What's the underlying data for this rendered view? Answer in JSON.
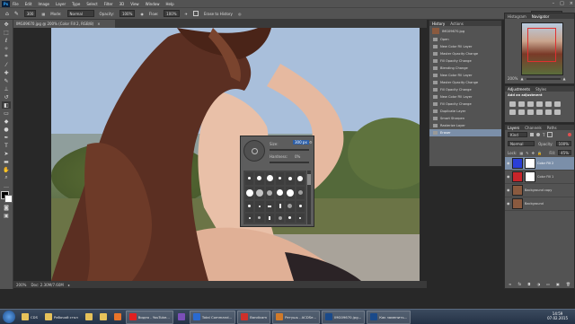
{
  "app": {
    "logo": "Ps"
  },
  "menu": [
    "File",
    "Edit",
    "Image",
    "Layer",
    "Type",
    "Select",
    "Filter",
    "3D",
    "View",
    "Window",
    "Help"
  ],
  "options_bar": {
    "tool_icon": "brush-icon",
    "size_value": "300",
    "mode_label": "Mode:",
    "mode_value": "Normal",
    "opacity_label": "Opacity:",
    "opacity_value": "100%",
    "flow_label": "Flow:",
    "flow_value": "100%",
    "erase_history_label": "Erase to History",
    "workspace": "Photography"
  },
  "document": {
    "tab_title": "IMG09670.jpg @ 200% (Color Fill 2, RGB/8)",
    "zoom": "200%",
    "doc_size": "Doc: 2.30M/7.60M"
  },
  "history": {
    "tabs": [
      "History",
      "Actions"
    ],
    "snapshot": "IMG09670.jpg",
    "items": [
      "Open",
      "New Color Fill Layer",
      "Master Opacity Change",
      "Fill Opacity Change",
      "Blending Change",
      "New Color Fill Layer",
      "Master Opacity Change",
      "Fill Opacity Change",
      "New Color Fill Layer",
      "Fill Opacity Change",
      "Duplicate Layer",
      "Smart Sharpen",
      "Rasterize Layer",
      "Eraser"
    ],
    "selected_index": 13
  },
  "navigator": {
    "tabs": [
      "Histogram",
      "Navigator"
    ],
    "zoom": "200%"
  },
  "adjustments": {
    "tabs": [
      "Adjustments",
      "Styles"
    ],
    "subtitle": "Add an adjustment"
  },
  "layers": {
    "tabs": [
      "Layers",
      "Channels",
      "Paths"
    ],
    "kind_label": "Kind",
    "blend_mode": "Normal",
    "opacity_label": "Opacity:",
    "opacity_value": "100%",
    "lock_label": "Lock:",
    "fill_label": "Fill:",
    "fill_value": "45%",
    "items": [
      {
        "name": "Color Fill 2",
        "selected": true,
        "swatch": "#2a3fd8"
      },
      {
        "name": "Color Fill 1",
        "selected": false,
        "swatch": "#c8252a"
      },
      {
        "name": "Background copy",
        "selected": false,
        "swatch": "#8a5a3f"
      },
      {
        "name": "Background",
        "selected": false,
        "swatch": "#8a5a3f"
      }
    ]
  },
  "brush_picker": {
    "size_label": "Size:",
    "size_value": "300 px",
    "hardness_label": "Hardness:",
    "hardness_value": "0%"
  },
  "taskbar": {
    "items": [
      {
        "label": "CDS",
        "icon": "folder-icon",
        "color": "#e6c25a"
      },
      {
        "label": "Рабочий стол",
        "icon": "folder-icon",
        "color": "#e6c25a"
      },
      {
        "label": "",
        "icon": "folder-icon",
        "color": "#e6c25a"
      },
      {
        "label": "",
        "icon": "folder-icon",
        "color": "#e6c25a"
      },
      {
        "label": "",
        "icon": "firefox-icon",
        "color": "#e8742a"
      },
      {
        "label": "Видео - YouTube...",
        "icon": "youtube-icon",
        "color": "#e02020"
      },
      {
        "label": "",
        "icon": "viber-icon",
        "color": "#7a4fb8"
      },
      {
        "label": "Total Command...",
        "icon": "totalcmd-icon",
        "color": "#2a6ad0"
      },
      {
        "label": "Bandicam",
        "icon": "bandicam-icon",
        "color": "#d0302a"
      },
      {
        "label": "Ретушь - ACDSe...",
        "icon": "acdsee-icon",
        "color": "#d07a2a"
      },
      {
        "label": "IMG09670.jpg...",
        "icon": "photoshop-icon",
        "color": "#1a4a8a"
      },
      {
        "label": "Как заменить...",
        "icon": "photoshop-icon",
        "color": "#1a4a8a"
      }
    ],
    "time": "14:59",
    "date": "07.02.2015"
  }
}
